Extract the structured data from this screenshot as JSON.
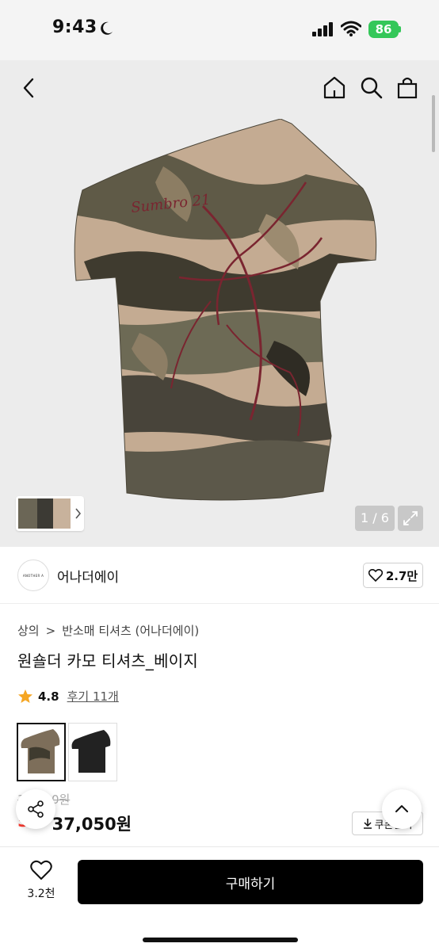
{
  "status_bar": {
    "time": "9:43",
    "battery": "86"
  },
  "gallery": {
    "counter": "1 / 6"
  },
  "brand": {
    "logo_text": "ANOTHER A",
    "name": "어나더에이",
    "likes": "2.7만"
  },
  "breadcrumb": {
    "category": "상의",
    "separator": ">",
    "subcategory": "반소매 티셔츠 (어나더에이)"
  },
  "product": {
    "title": "원숄더 카모 티셔츠_베이지",
    "rating": "4.8",
    "reviews": "후기 11개",
    "original_price": "39,000원",
    "discount": "5%",
    "sale_price": "37,050원",
    "coupon_label": "쿠폰받기"
  },
  "bottom_bar": {
    "wish_count": "3.2천",
    "buy_label": "구매하기"
  },
  "colors": {
    "accent": "#ff3b30",
    "battery": "#34c759",
    "primary_button": "#000000",
    "star": "#f5a623"
  },
  "icons": [
    "moon-icon",
    "signal-icon",
    "wifi-icon",
    "back-icon",
    "home-icon",
    "search-icon",
    "bag-icon",
    "expand-icon",
    "heart-icon",
    "star-icon",
    "share-icon",
    "download-icon",
    "chevron-up-icon"
  ]
}
